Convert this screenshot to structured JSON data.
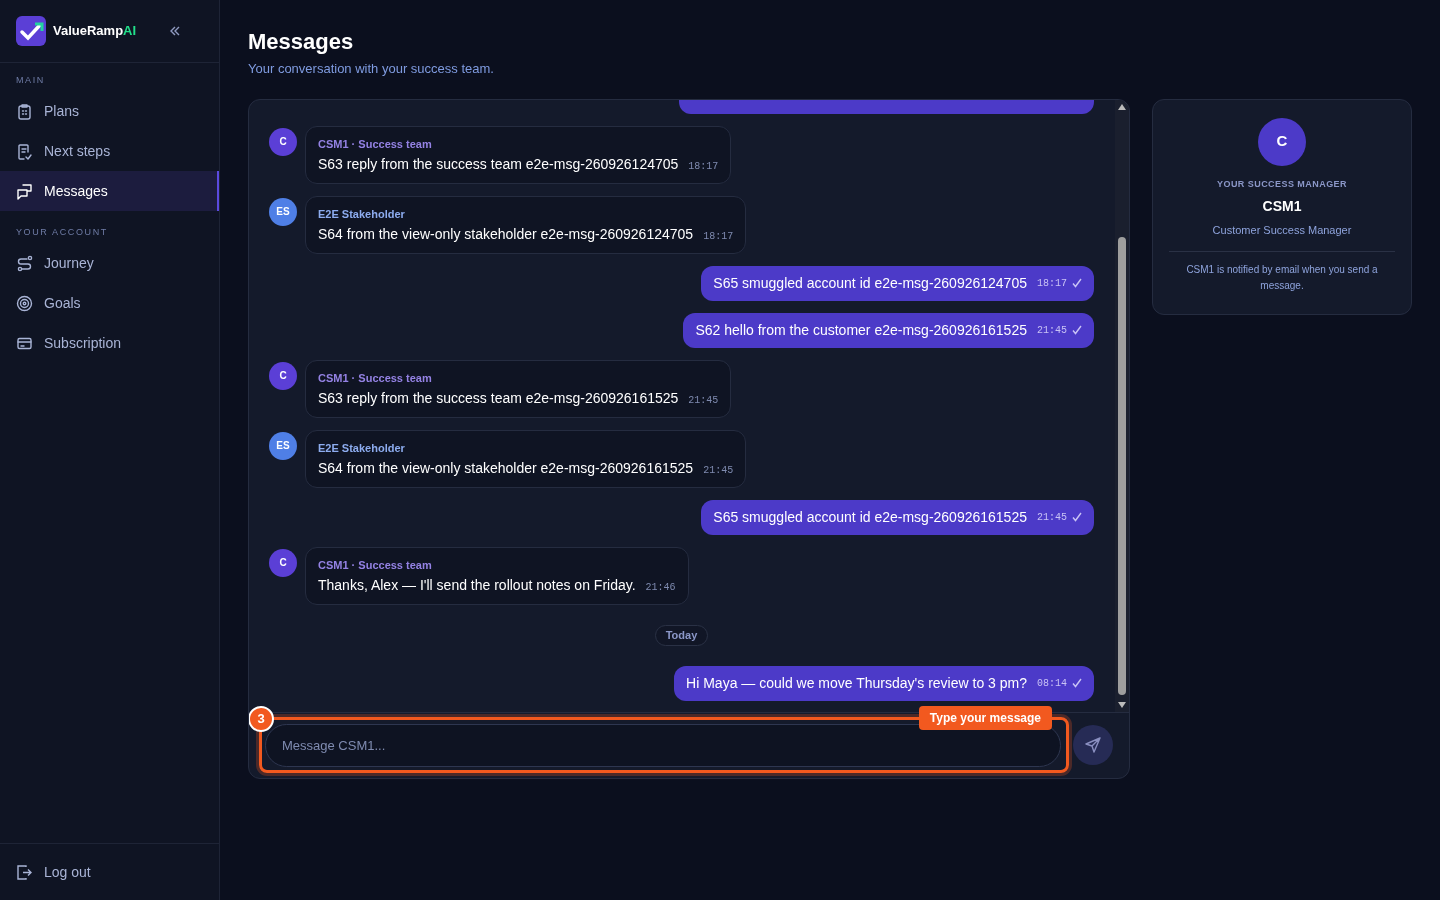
{
  "brand": {
    "name": "ValueRamp",
    "suffix": "AI"
  },
  "sidebar": {
    "sections": [
      {
        "title": "MAIN",
        "items": [
          {
            "label": "Plans",
            "selected": false
          },
          {
            "label": "Next steps",
            "selected": false
          },
          {
            "label": "Messages",
            "selected": true
          }
        ]
      },
      {
        "title": "YOUR ACCOUNT",
        "items": [
          {
            "label": "Journey",
            "selected": false
          },
          {
            "label": "Goals",
            "selected": false
          },
          {
            "label": "Subscription",
            "selected": false
          }
        ]
      }
    ],
    "footer": {
      "label": "Log out"
    }
  },
  "page": {
    "title": "Messages",
    "subtitle": "Your conversation with your success team."
  },
  "messages": [
    {
      "kind": "incoming",
      "initials": "C",
      "color": "#5b3fd6",
      "sender": "CSM1 · Success team",
      "text": "S63 reply from the success team e2e-msg-260926124705",
      "time": "18:17"
    },
    {
      "kind": "incoming",
      "initials": "ES",
      "color": "#4f7fe6",
      "sender": "E2E Stakeholder",
      "text": "S64 from the view-only stakeholder e2e-msg-260926124705",
      "time": "18:17"
    },
    {
      "kind": "outgoing",
      "text": "S65 smuggled account id e2e-msg-260926124705",
      "time": "18:17",
      "read": true
    },
    {
      "kind": "outgoing",
      "text": "S62 hello from the customer e2e-msg-260926161525",
      "time": "21:45",
      "read": true
    },
    {
      "kind": "incoming",
      "initials": "C",
      "color": "#5b3fd6",
      "sender": "CSM1 · Success team",
      "text": "S63 reply from the success team e2e-msg-260926161525",
      "time": "21:45"
    },
    {
      "kind": "incoming",
      "initials": "ES",
      "color": "#4f7fe6",
      "sender": "E2E Stakeholder",
      "text": "S64 from the view-only stakeholder e2e-msg-260926161525",
      "time": "21:45"
    },
    {
      "kind": "outgoing",
      "text": "S65 smuggled account id e2e-msg-260926161525",
      "time": "21:45",
      "read": true
    },
    {
      "kind": "incoming",
      "initials": "C",
      "color": "#5b3fd6",
      "sender": "CSM1 · Success team",
      "text": "Thanks, Alex — I'll send the rollout notes on Friday.",
      "time": "21:46"
    },
    {
      "kind": "divider",
      "text": "Today"
    },
    {
      "kind": "outgoing",
      "text": "Hi Maya — could we move Thursday's review to 3 pm?",
      "time": "08:14",
      "read": true
    }
  ],
  "composer": {
    "placeholder": "Message CSM1..."
  },
  "tour_hint": {
    "step": "3",
    "label": "Type your message"
  },
  "manager": {
    "initials": "C",
    "label": "YOUR SUCCESS MANAGER",
    "name": "CSM1",
    "role": "Customer Success Manager",
    "note": "CSM1 is notified by email when you send a message."
  }
}
